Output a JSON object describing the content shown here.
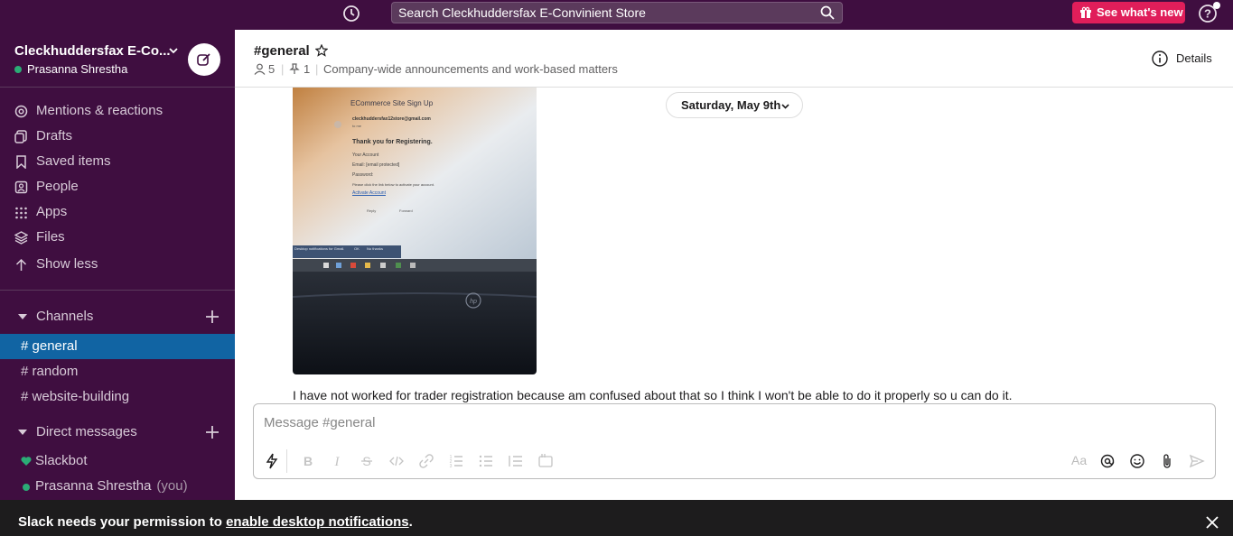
{
  "topbar": {
    "search_placeholder": "Search Cleckhuddersfax E-Convinient Store",
    "whats_new_label": "See what's new",
    "icons": [
      "history-icon",
      "search-icon",
      "gift-icon",
      "help-icon"
    ]
  },
  "workspace": {
    "name": "Cleckhuddersfax E-Co...",
    "user": "Prasanna Shrestha",
    "user_status_color": "#2bac76"
  },
  "sidebar": {
    "nav": [
      {
        "label": "Mentions & reactions",
        "icon": "at-icon"
      },
      {
        "label": "Drafts",
        "icon": "drafts-icon"
      },
      {
        "label": "Saved items",
        "icon": "bookmark-icon"
      },
      {
        "label": "People",
        "icon": "people-icon"
      },
      {
        "label": "Apps",
        "icon": "apps-grid-icon"
      },
      {
        "label": "Files",
        "icon": "files-layers-icon"
      },
      {
        "label": "Show less",
        "icon": "arrow-up-icon"
      }
    ],
    "channels_header": "Channels",
    "channels": [
      {
        "hash": "#",
        "name": "general",
        "active": true
      },
      {
        "hash": "#",
        "name": "random",
        "active": false
      },
      {
        "hash": "#",
        "name": "website-building",
        "active": false
      }
    ],
    "dms_header": "Direct messages",
    "dms": [
      {
        "name": "Slackbot",
        "you": ""
      },
      {
        "name": "Prasanna Shrestha",
        "you": "(you)"
      }
    ]
  },
  "channel": {
    "name": "#general",
    "members": "5",
    "pins": "1",
    "topic": "Company-wide announcements and work-based matters",
    "details_label": "Details"
  },
  "messages": {
    "date_divider": "Saturday, May 9th",
    "image_screen": {
      "title": "ECommerce Site Sign Up",
      "sender": "cleckhuddersfax12store@gmail.com",
      "to": "to me",
      "heading": "Thank you for Registering.",
      "line1": "Your Account",
      "line2": "Email: [email protected]",
      "line3": "Password: ",
      "line4": "Please click the link below to activate your account.",
      "link": "Activate Account",
      "reply": "Reply",
      "forward": "Forward",
      "notice": "Desktop notifications for Gmail.",
      "ok": "OK",
      "no_thanks": "No thanks"
    },
    "text": "I have not worked for trader registration because am confused about that so I think I won't be able to do it properly so u can do it."
  },
  "composer": {
    "placeholder": "Message #general",
    "format_label": "Aa"
  },
  "banner": {
    "text_before": "Slack needs your permission to ",
    "link_text": "enable desktop notifications",
    "text_after": "."
  },
  "colors": {
    "sidebar_bg": "#3f0e40",
    "active_channel": "#1164a3",
    "whats_new_button": "#e01e5a",
    "online": "#2bac76"
  }
}
